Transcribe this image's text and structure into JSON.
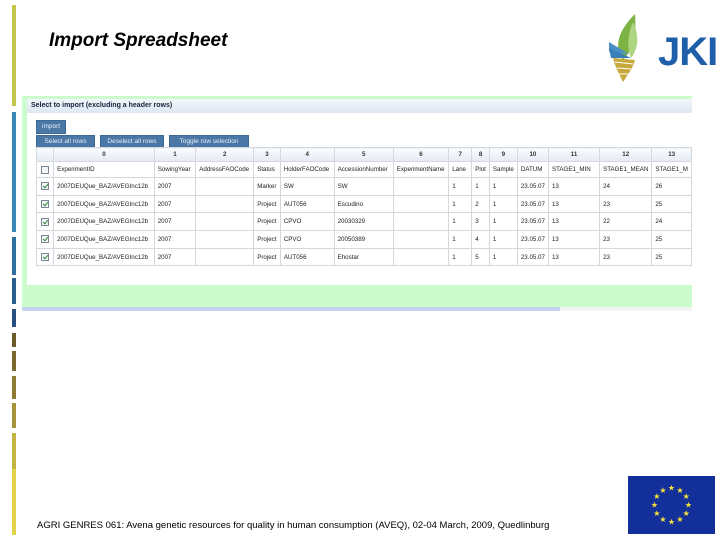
{
  "slide": {
    "title": "Import Spreadsheet",
    "footer": "AGRI GENRES 061: Avena genetic resources for quality in human consumption (AVEQ), 02-04 March, 2009, Quedlinburg"
  },
  "logo": {
    "text": "JKI",
    "icon": "jki-flame-logo"
  },
  "eu_flag": {
    "icon": "eu-flag-icon"
  },
  "importer": {
    "panel_title": "Select to import (excluding a header rows)",
    "buttons": {
      "import": "import",
      "select_all": "Select all rows",
      "deselect_all": "Deselect all rows",
      "toggle": "Toggle row selection"
    },
    "column_indices": [
      "0",
      "1",
      "2",
      "3",
      "4",
      "5",
      "6",
      "7",
      "8",
      "9",
      "10",
      "11",
      "12",
      "13"
    ],
    "header_row": {
      "checked": false,
      "cells": [
        "ExperimentID",
        "SowingYear",
        "AddressFAOCode",
        "Status",
        "HolderFAOCode",
        "AccessionNumber",
        "ExperimentName",
        "Lane",
        "Plot",
        "Sample",
        "DATUM",
        "STAGE1_MIN",
        "STAGE1_MEAN",
        "STAGE1_M"
      ]
    },
    "rows": [
      {
        "checked": true,
        "cells": [
          "2007DEUQue_BAZ/AVEGInc12b",
          "2007",
          "",
          "Marker",
          "SW",
          "SW",
          "",
          "1",
          "1",
          "1",
          "23.05.07",
          "13",
          "24",
          "26"
        ]
      },
      {
        "checked": true,
        "cells": [
          "2007DEUQue_BAZ/AVEGInc12b",
          "2007",
          "",
          "Project",
          "AUT056",
          "Escudino",
          "",
          "1",
          "2",
          "1",
          "23.05.07",
          "13",
          "23",
          "25"
        ]
      },
      {
        "checked": true,
        "cells": [
          "2007DEUQue_BAZ/AVEGInc12b",
          "2007",
          "",
          "Project",
          "CPVO",
          "20030329",
          "",
          "1",
          "3",
          "1",
          "23.05.07",
          "13",
          "22",
          "24"
        ]
      },
      {
        "checked": true,
        "cells": [
          "2007DEUQue_BAZ/AVEGInc12b",
          "2007",
          "",
          "Project",
          "CPVO",
          "20050389",
          "",
          "1",
          "4",
          "1",
          "23.05.07",
          "13",
          "23",
          "25"
        ]
      },
      {
        "checked": true,
        "cells": [
          "2007DEUQue_BAZ/AVEGInc12b",
          "2007",
          "",
          "Project",
          "AUT056",
          "Ehostar",
          "",
          "1",
          "5",
          "1",
          "23.05.07",
          "13",
          "23",
          "25"
        ]
      }
    ]
  },
  "colors": {
    "panel_bg": "#ccfccc",
    "button_bg": "#4a77a6",
    "logo_blue": "#1f5ea8",
    "eu_blue": "#13309a",
    "eu_star": "#f5e23a"
  }
}
